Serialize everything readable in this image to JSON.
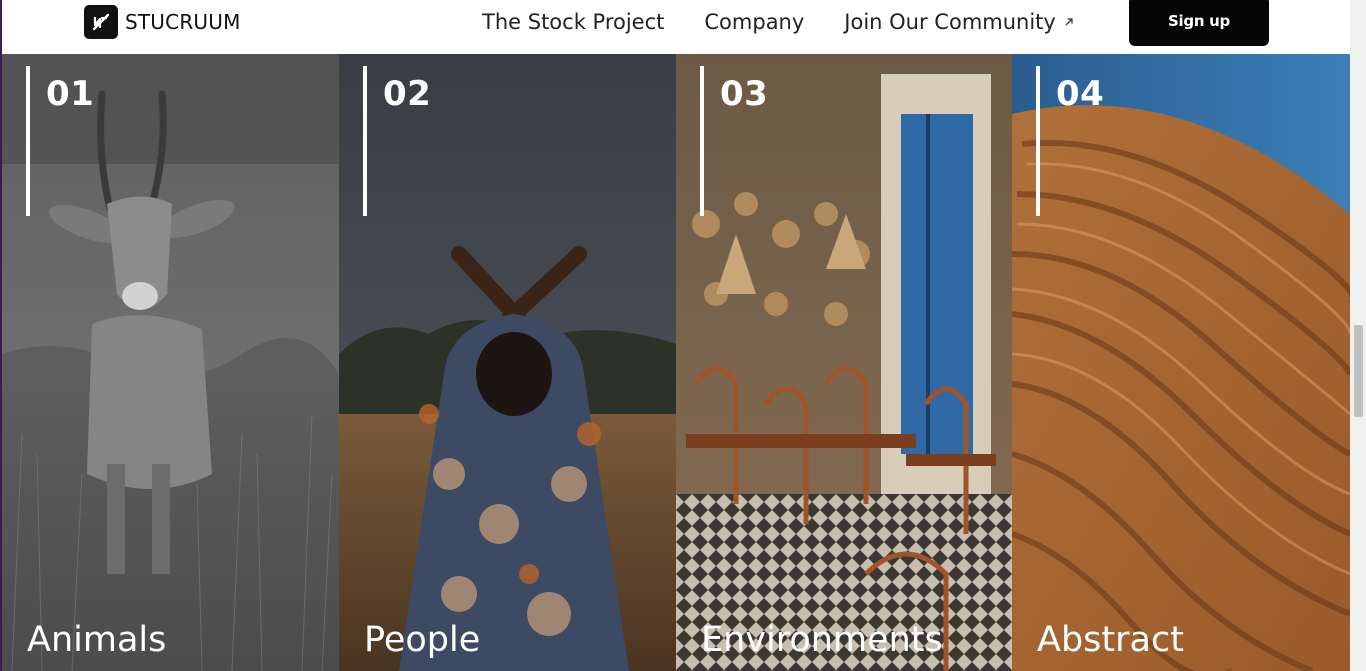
{
  "brand": {
    "name": "STUCRUUM",
    "logo_icon": "stucruum-logo-icon"
  },
  "nav": {
    "links": [
      {
        "label": "The Stock Project"
      },
      {
        "label": "Company"
      },
      {
        "label": "Join Our Community",
        "icon": "external-arrow-icon"
      }
    ],
    "signup_label": "Sign up"
  },
  "categories": [
    {
      "number": "01",
      "title": "Animals",
      "image": "grayscale antelope in grass"
    },
    {
      "number": "02",
      "title": "People",
      "image": "woman with crossed arms in field"
    },
    {
      "number": "03",
      "title": "Environments",
      "image": "cafe interior with patterned walls"
    },
    {
      "number": "04",
      "title": "Abstract",
      "image": "rippled sand dune under blue sky"
    }
  ],
  "colors": {
    "accent": "#050505",
    "header_bg": "#ffffff",
    "text_on_image": "#ffffff"
  }
}
